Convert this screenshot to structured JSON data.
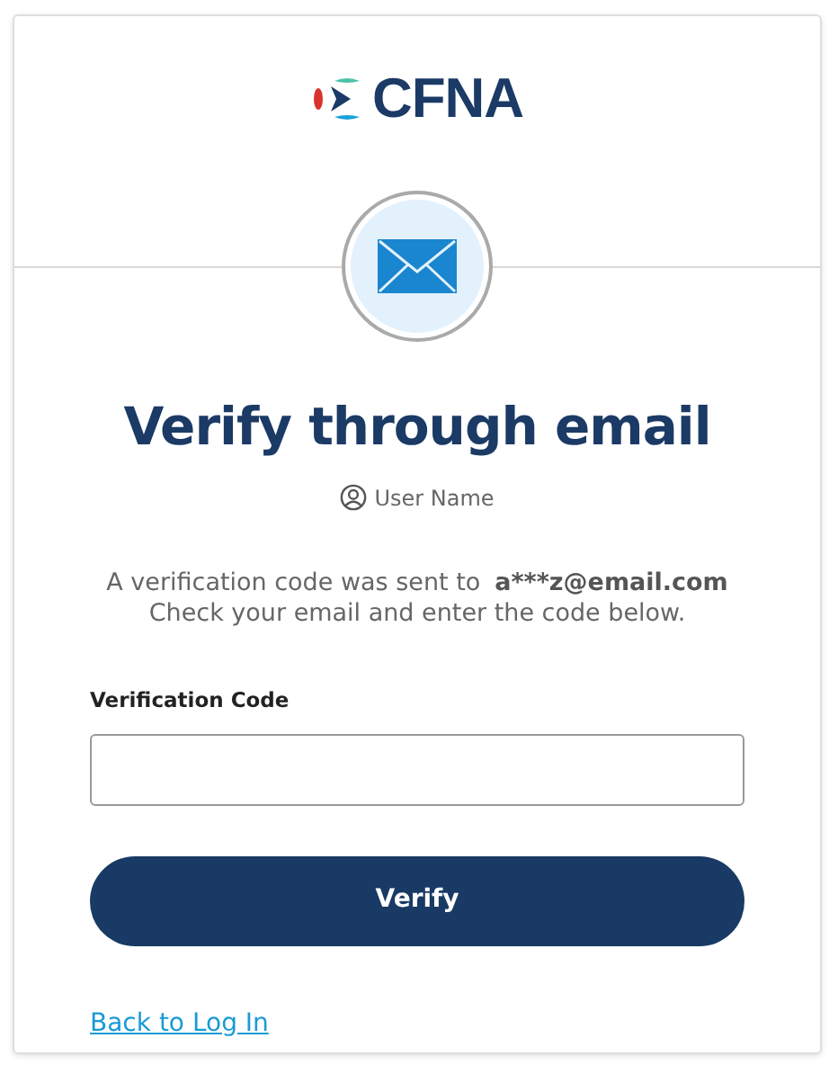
{
  "logo": {
    "text": "CFNA"
  },
  "title": "Verify through email",
  "user": {
    "label": "User Name"
  },
  "message": {
    "line1": "A verification code was sent to",
    "email": "a***z@email.com",
    "line2": "Check your email and enter the code below."
  },
  "field": {
    "label": "Verification Code"
  },
  "button": {
    "label": "Verify"
  },
  "link": {
    "label": "Back to Log In"
  }
}
